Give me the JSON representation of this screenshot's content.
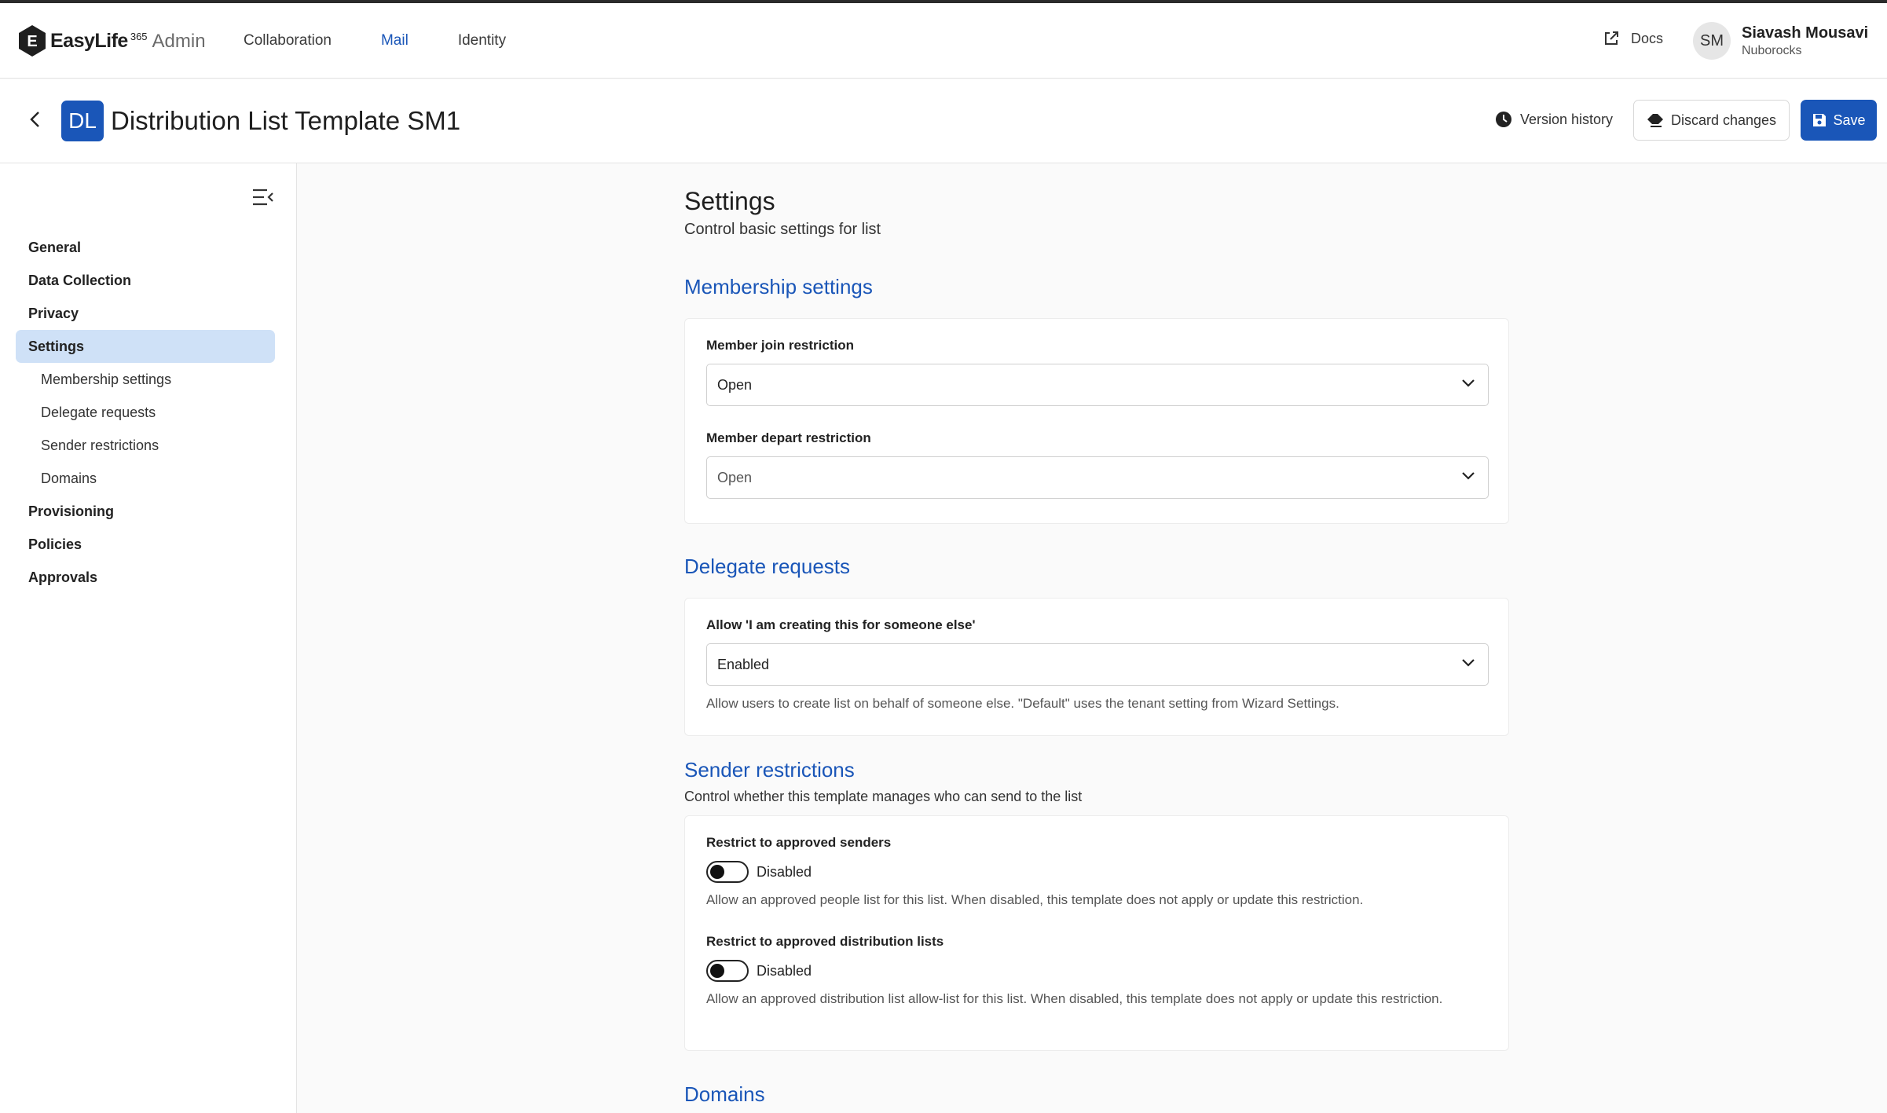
{
  "app": {
    "brand": "EasyLife",
    "brand_sup": "365",
    "brand_suffix": "Admin",
    "logo_letter": "E"
  },
  "topnav": {
    "links": [
      {
        "label": "Collaboration",
        "active": false
      },
      {
        "label": "Mail",
        "active": true
      },
      {
        "label": "Identity",
        "active": false
      }
    ],
    "docs_label": "Docs",
    "user": {
      "initials": "SM",
      "name": "Siavash Mousavi",
      "org": "Nuborocks"
    }
  },
  "header": {
    "badge": "DL",
    "title": "Distribution List Template SM1",
    "version_history": "Version history",
    "discard": "Discard changes",
    "save": "Save"
  },
  "sidebar": {
    "items": [
      {
        "label": "General",
        "level": 1,
        "active": false
      },
      {
        "label": "Data Collection",
        "level": 1,
        "active": false
      },
      {
        "label": "Privacy",
        "level": 1,
        "active": false
      },
      {
        "label": "Settings",
        "level": 1,
        "active": true
      },
      {
        "label": "Membership settings",
        "level": 2,
        "active": false
      },
      {
        "label": "Delegate requests",
        "level": 2,
        "active": false
      },
      {
        "label": "Sender restrictions",
        "level": 2,
        "active": false
      },
      {
        "label": "Domains",
        "level": 2,
        "active": false
      },
      {
        "label": "Provisioning",
        "level": 1,
        "active": false
      },
      {
        "label": "Policies",
        "level": 1,
        "active": false
      },
      {
        "label": "Approvals",
        "level": 1,
        "active": false
      }
    ]
  },
  "main": {
    "title": "Settings",
    "subtitle": "Control basic settings for list",
    "membership": {
      "title": "Membership settings",
      "join_label": "Member join restriction",
      "join_value": "Open",
      "depart_label": "Member depart restriction",
      "depart_value": "Open"
    },
    "delegate": {
      "title": "Delegate requests",
      "label": "Allow 'I am creating this for someone else'",
      "value": "Enabled",
      "help": "Allow users to create list on behalf of someone else. \"Default\" uses the tenant setting from Wizard Settings."
    },
    "sender": {
      "title": "Sender restrictions",
      "desc": "Control whether this template manages who can send to the list",
      "senders_label": "Restrict to approved senders",
      "senders_state": "Disabled",
      "senders_help": "Allow an approved people list for this list. When disabled, this template does not apply or update this restriction.",
      "lists_label": "Restrict to approved distribution lists",
      "lists_state": "Disabled",
      "lists_help": "Allow an approved distribution list allow-list for this list. When disabled, this template does not apply or update this restriction."
    },
    "domains": {
      "title": "Domains"
    }
  },
  "colors": {
    "accent": "#1a56b8",
    "active_nav_bg": "#cfe1f7"
  }
}
